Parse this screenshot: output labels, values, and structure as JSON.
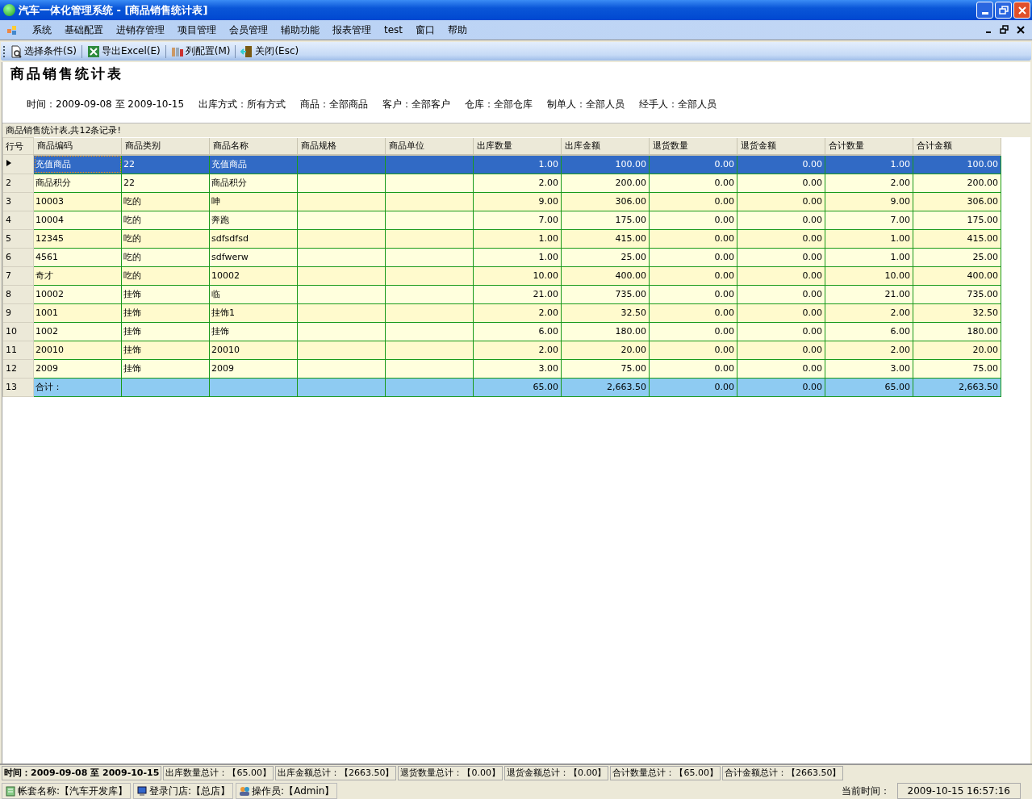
{
  "window": {
    "title": "汽车一体化管理系统 - [商品销售统计表]"
  },
  "menu": [
    "系统",
    "基础配置",
    "进销存管理",
    "项目管理",
    "会员管理",
    "辅助功能",
    "报表管理",
    "test",
    "窗口",
    "帮助"
  ],
  "toolbar": [
    {
      "label": "选择条件(S)",
      "kind": "search"
    },
    {
      "label": "导出Excel(E)",
      "kind": "excel"
    },
    {
      "label": "列配置(M)",
      "kind": "columns"
    },
    {
      "label": "关闭(Esc)",
      "kind": "exit"
    }
  ],
  "report": {
    "title": "商品销售统计表",
    "filters": [
      "时间：2009-09-08 至 2009-10-15",
      "出库方式：所有方式",
      "商品：全部商品",
      "客户：全部客户",
      "仓库：全部仓库",
      "制单人：全部人员",
      "经手人：全部人员"
    ]
  },
  "grid": {
    "caption": "商品销售统计表,共12条记录!",
    "row_header": "行号",
    "columns": [
      {
        "label": "商品编码",
        "kind": "text"
      },
      {
        "label": "商品类别",
        "kind": "text"
      },
      {
        "label": "商品名称",
        "kind": "text"
      },
      {
        "label": "商品规格",
        "kind": "text"
      },
      {
        "label": "商品单位",
        "kind": "text"
      },
      {
        "label": "出库数量",
        "kind": "number"
      },
      {
        "label": "出库金额",
        "kind": "number"
      },
      {
        "label": "退货数量",
        "kind": "number"
      },
      {
        "label": "退货金额",
        "kind": "number"
      },
      {
        "label": "合计数量",
        "kind": "number"
      },
      {
        "label": "合计金额",
        "kind": "number"
      }
    ],
    "rows": [
      {
        "selected": true,
        "kind": "data",
        "cells": [
          "充值商品",
          "22",
          "充值商品",
          "",
          "",
          "1.00",
          "100.00",
          "0.00",
          "0.00",
          "1.00",
          "100.00"
        ]
      },
      {
        "no": "2",
        "selected": false,
        "kind": "data",
        "cells": [
          "商品积分",
          "22",
          "商品积分",
          "",
          "",
          "2.00",
          "200.00",
          "0.00",
          "0.00",
          "2.00",
          "200.00"
        ]
      },
      {
        "no": "3",
        "selected": false,
        "kind": "data",
        "cells": [
          "10003",
          "吃的",
          "呻",
          "",
          "",
          "9.00",
          "306.00",
          "0.00",
          "0.00",
          "9.00",
          "306.00"
        ]
      },
      {
        "no": "4",
        "selected": false,
        "kind": "data",
        "cells": [
          "10004",
          "吃的",
          "奔跑",
          "",
          "",
          "7.00",
          "175.00",
          "0.00",
          "0.00",
          "7.00",
          "175.00"
        ]
      },
      {
        "no": "5",
        "selected": false,
        "kind": "data",
        "cells": [
          "12345",
          "吃的",
          "sdfsdfsd",
          "",
          "",
          "1.00",
          "415.00",
          "0.00",
          "0.00",
          "1.00",
          "415.00"
        ]
      },
      {
        "no": "6",
        "selected": false,
        "kind": "data",
        "cells": [
          "4561",
          "吃的",
          "sdfwerw",
          "",
          "",
          "1.00",
          "25.00",
          "0.00",
          "0.00",
          "1.00",
          "25.00"
        ]
      },
      {
        "no": "7",
        "selected": false,
        "kind": "data",
        "cells": [
          "奇才",
          "吃的",
          "10002",
          "",
          "",
          "10.00",
          "400.00",
          "0.00",
          "0.00",
          "10.00",
          "400.00"
        ]
      },
      {
        "no": "8",
        "selected": false,
        "kind": "data",
        "cells": [
          "10002",
          "挂饰",
          "临",
          "",
          "",
          "21.00",
          "735.00",
          "0.00",
          "0.00",
          "21.00",
          "735.00"
        ]
      },
      {
        "no": "9",
        "selected": false,
        "kind": "data",
        "cells": [
          "1001",
          "挂饰",
          "挂饰1",
          "",
          "",
          "2.00",
          "32.50",
          "0.00",
          "0.00",
          "2.00",
          "32.50"
        ]
      },
      {
        "no": "10",
        "selected": false,
        "kind": "data",
        "cells": [
          "1002",
          "挂饰",
          "挂饰",
          "",
          "",
          "6.00",
          "180.00",
          "0.00",
          "0.00",
          "6.00",
          "180.00"
        ]
      },
      {
        "no": "11",
        "selected": false,
        "kind": "data",
        "cells": [
          "20010",
          "挂饰",
          "20010",
          "",
          "",
          "2.00",
          "20.00",
          "0.00",
          "0.00",
          "2.00",
          "20.00"
        ]
      },
      {
        "no": "12",
        "selected": false,
        "kind": "data",
        "cells": [
          "2009",
          "挂饰",
          "2009",
          "",
          "",
          "3.00",
          "75.00",
          "0.00",
          "0.00",
          "3.00",
          "75.00"
        ]
      },
      {
        "no": "13",
        "selected": false,
        "kind": "total",
        "cells": [
          "合计：",
          "",
          "",
          "",
          "",
          "65.00",
          "2,663.50",
          "0.00",
          "0.00",
          "65.00",
          "2,663.50"
        ]
      }
    ]
  },
  "summary": [
    "时间：2009-09-08 至 2009-10-15",
    "出库数量总计：【65.00】",
    "出库金额总计：【2663.50】",
    "退货数量总计：【0.00】",
    "退货金额总计：【0.00】",
    "合计数量总计：【65.00】",
    "合计金额总计：【2663.50】"
  ],
  "status_bar": {
    "items": [
      {
        "label": "帐套名称:【汽车开发库】",
        "kind": "book"
      },
      {
        "label": "登录门店:【总店】",
        "kind": "store"
      },
      {
        "label": "操作员:【Admin】",
        "kind": "users"
      }
    ],
    "time_label": "当前时间：",
    "time": "2009-10-15 16:57:16"
  }
}
